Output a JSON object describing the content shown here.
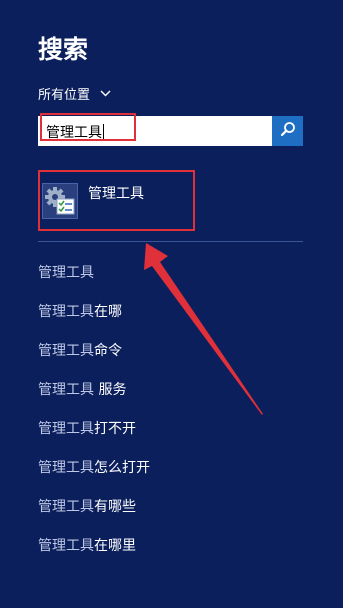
{
  "header": {
    "title": "搜索"
  },
  "scope": {
    "label": "所有位置"
  },
  "search": {
    "value": "管理工具"
  },
  "top_result": {
    "label": "管理工具",
    "icon": "admin-tools-icon"
  },
  "suggestions": [
    {
      "query": "管理工具",
      "suffix": ""
    },
    {
      "query": "管理工具",
      "suffix": "在哪"
    },
    {
      "query": "管理工具",
      "suffix": "命令"
    },
    {
      "query": "管理工具",
      "suffix": " 服务"
    },
    {
      "query": "管理工具",
      "suffix": "打不开"
    },
    {
      "query": "管理工具",
      "suffix": "怎么打开"
    },
    {
      "query": "管理工具",
      "suffix": "有哪些"
    },
    {
      "query": "管理工具",
      "suffix": "在哪里"
    }
  ],
  "colors": {
    "background": "#0b1f5c",
    "search_button": "#1e6fc3",
    "annotation": "#e0303a"
  }
}
